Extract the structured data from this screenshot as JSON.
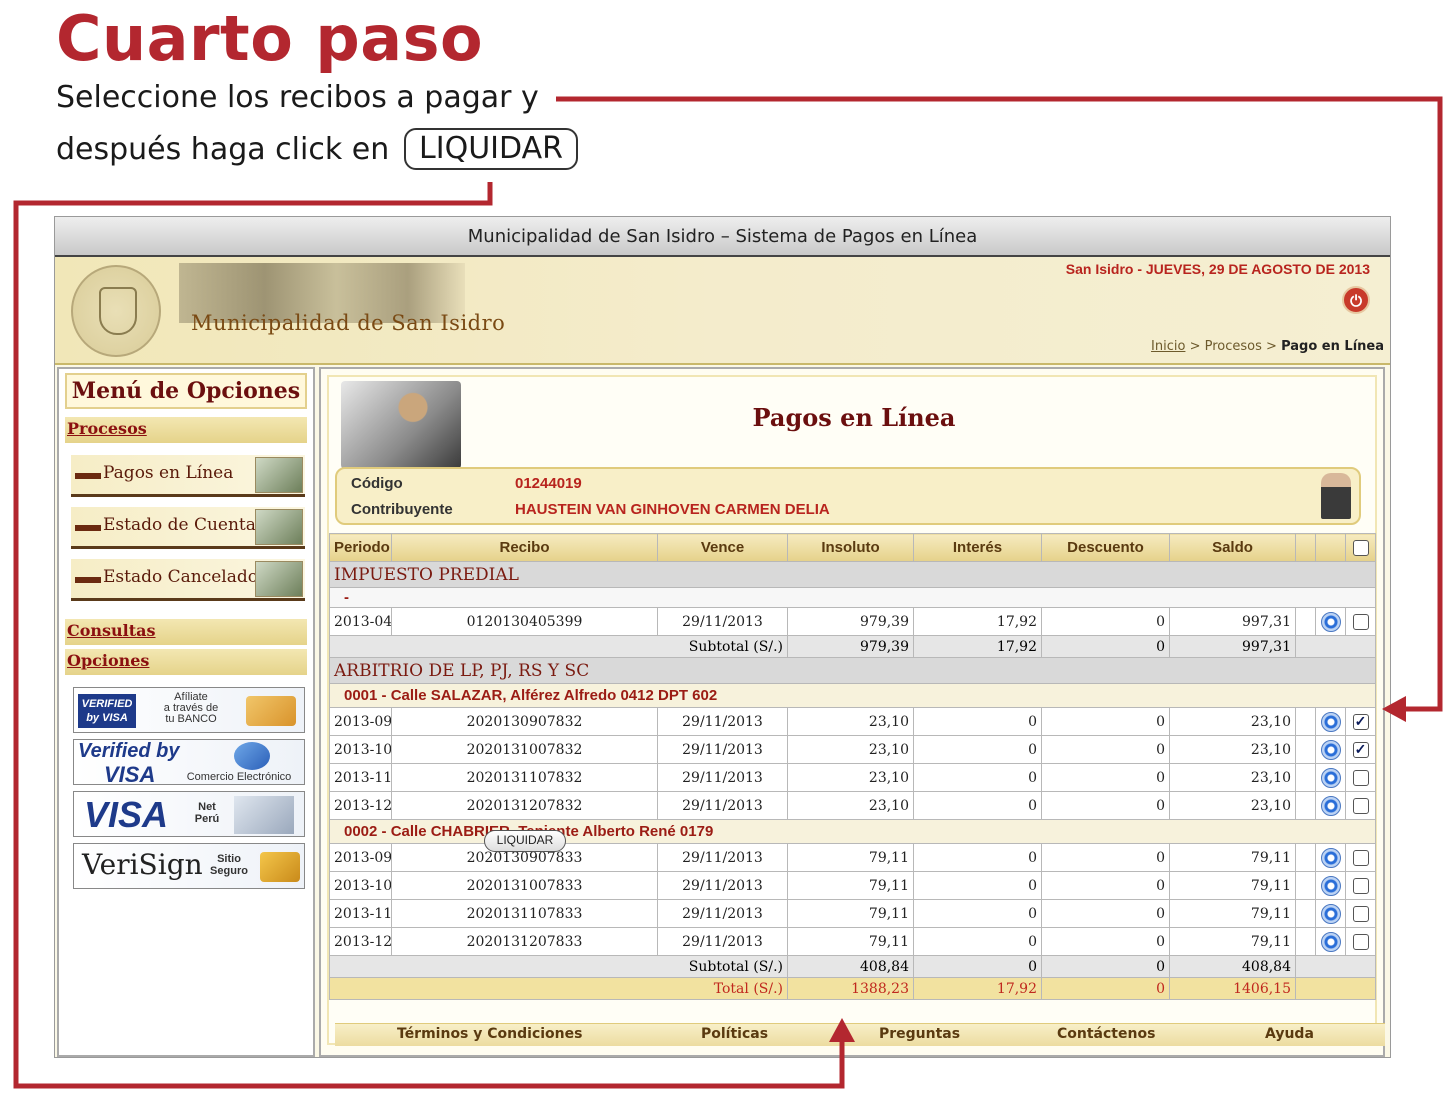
{
  "instructions": {
    "title": "Cuarto paso",
    "line1": "Seleccione los recibos a pagar y",
    "line2": "después haga click en",
    "button_label": "LIQUIDAR"
  },
  "window": {
    "title": "Municipalidad de San Isidro – Sistema de Pagos en Línea"
  },
  "header": {
    "org_name": "Municipalidad de San Isidro",
    "date": "San Isidro - JUEVES, 29 DE AGOSTO DE 2013",
    "breadcrumb": {
      "home": "Inicio",
      "sep": ">",
      "section": "Procesos",
      "current": "Pago en Línea"
    }
  },
  "sidebar": {
    "title": "Menú de Opciones",
    "sections": {
      "procesos": "Procesos",
      "consultas": "Consultas",
      "opciones": "Opciones"
    },
    "items": [
      "Pagos en Línea",
      "Estado de Cuenta",
      "Estado Cancelado"
    ],
    "badges": {
      "verified_bank": {
        "logo": "VERIFIED by VISA",
        "text1": "Afíliate",
        "text2": "a través de",
        "text3": "tu BANCO"
      },
      "verified_commerce": {
        "logo1": "Verified by",
        "logo2": "VISA",
        "text": "Comercio Electrónico"
      },
      "visa_net": {
        "logo": "VISA",
        "text1": "Net",
        "text2": "Perú"
      },
      "verisign": {
        "logo": "VeriSign",
        "text1": "Sitio",
        "text2": "Seguro"
      }
    }
  },
  "main": {
    "heading": "Pagos en Línea",
    "codigo_label": "Código",
    "codigo_value": "01244019",
    "contribuyente_label": "Contribuyente",
    "contribuyente_value": "HAUSTEIN VAN GINHOVEN CARMEN DELIA",
    "columns": [
      "Periodo",
      "Recibo",
      "Vence",
      "Insoluto",
      "Interés",
      "Descuento",
      "Saldo"
    ],
    "groups": [
      {
        "name": "IMPUESTO PREDIAL",
        "addresses": [
          {
            "name": "-",
            "rows": [
              {
                "periodo": "2013-04",
                "recibo": "0120130405399",
                "vence": "29/11/2013",
                "insoluto": "979,39",
                "interes": "17,92",
                "descuento": "0",
                "saldo": "997,31",
                "checked": false
              }
            ]
          }
        ],
        "subtotal": {
          "label": "Subtotal (S/.)",
          "insoluto": "979,39",
          "interes": "17,92",
          "descuento": "0",
          "saldo": "997,31"
        }
      },
      {
        "name": "ARBITRIO DE LP, PJ, RS Y SC",
        "addresses": [
          {
            "name": "0001 - Calle SALAZAR, Alférez Alfredo 0412 DPT 602",
            "rows": [
              {
                "periodo": "2013-09",
                "recibo": "2020130907832",
                "vence": "29/11/2013",
                "insoluto": "23,10",
                "interes": "0",
                "descuento": "0",
                "saldo": "23,10",
                "checked": true
              },
              {
                "periodo": "2013-10",
                "recibo": "2020131007832",
                "vence": "29/11/2013",
                "insoluto": "23,10",
                "interes": "0",
                "descuento": "0",
                "saldo": "23,10",
                "checked": true
              },
              {
                "periodo": "2013-11",
                "recibo": "2020131107832",
                "vence": "29/11/2013",
                "insoluto": "23,10",
                "interes": "0",
                "descuento": "0",
                "saldo": "23,10",
                "checked": false
              },
              {
                "periodo": "2013-12",
                "recibo": "2020131207832",
                "vence": "29/11/2013",
                "insoluto": "23,10",
                "interes": "0",
                "descuento": "0",
                "saldo": "23,10",
                "checked": false
              }
            ]
          },
          {
            "name": "0002 - Calle CHABRIER, Teniente Alberto René 0179",
            "rows": [
              {
                "periodo": "2013-09",
                "recibo": "2020130907833",
                "vence": "29/11/2013",
                "insoluto": "79,11",
                "interes": "0",
                "descuento": "0",
                "saldo": "79,11",
                "checked": false
              },
              {
                "periodo": "2013-10",
                "recibo": "2020131007833",
                "vence": "29/11/2013",
                "insoluto": "79,11",
                "interes": "0",
                "descuento": "0",
                "saldo": "79,11",
                "checked": false
              },
              {
                "periodo": "2013-11",
                "recibo": "2020131107833",
                "vence": "29/11/2013",
                "insoluto": "79,11",
                "interes": "0",
                "descuento": "0",
                "saldo": "79,11",
                "checked": false
              },
              {
                "periodo": "2013-12",
                "recibo": "2020131207833",
                "vence": "29/11/2013",
                "insoluto": "79,11",
                "interes": "0",
                "descuento": "0",
                "saldo": "79,11",
                "checked": false
              }
            ]
          }
        ],
        "subtotal": {
          "label": "Subtotal (S/.)",
          "insoluto": "408,84",
          "interes": "0",
          "descuento": "0",
          "saldo": "408,84"
        }
      }
    ],
    "total": {
      "label": "Total (S/.)",
      "insoluto": "1388,23",
      "interes": "17,92",
      "descuento": "0",
      "saldo": "1406,15"
    },
    "liquidar_label": "LIQUIDAR",
    "footer_links": [
      "Términos y Condiciones",
      "Políticas",
      "Preguntas",
      "Contáctenos",
      "Ayuda"
    ]
  },
  "colors": {
    "brand_red": "#b3272f",
    "header_gold": "#f1e7b8",
    "text_red": "#b8241e"
  },
  "icons": {
    "info": "info-circle-icon",
    "logout": "lock-logout-icon",
    "seal": "municipal-seal-icon"
  }
}
